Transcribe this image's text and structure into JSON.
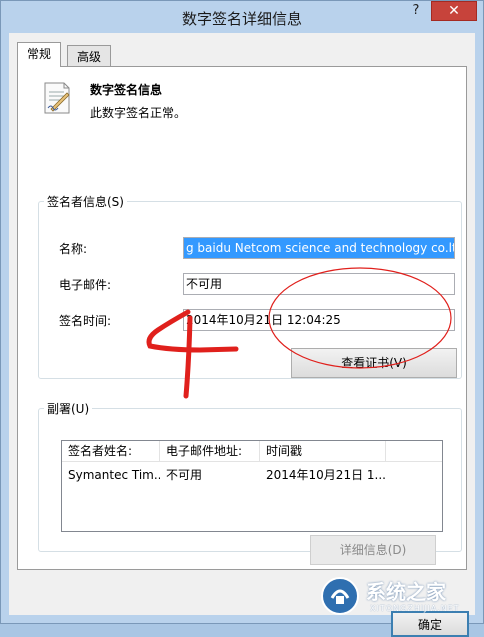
{
  "window": {
    "title": "数字签名详细信息",
    "help_label": "?",
    "close_label": "✕"
  },
  "tabs": [
    {
      "label": "常规"
    },
    {
      "label": "高级"
    }
  ],
  "info": {
    "title": "数字签名信息",
    "status": "此数字签名正常。"
  },
  "signer": {
    "legend": "签名者信息(S)",
    "name_label": "名称:",
    "name_value": "g baidu Netcom science and technology co.ltd",
    "email_label": "电子邮件:",
    "email_value": "不可用",
    "time_label": "签名时间:",
    "time_value": "2014年10月21日 12:04:25",
    "view_cert_button": "查看证书(V)"
  },
  "countersign": {
    "legend": "副署(U)",
    "columns": [
      "签名者姓名:",
      "电子邮件地址:",
      "时间戳"
    ],
    "rows": [
      {
        "name": "Symantec Tim...",
        "email": "不可用",
        "timestamp": "2014年10月21日 1..."
      }
    ],
    "details_button": "详细信息(D)"
  },
  "ok_button": "确定",
  "annotation": {
    "number": "4",
    "color": "#e0201c"
  },
  "watermark": {
    "text": "系统之家",
    "sub": "XITONGZHIJIA.NET"
  },
  "colors": {
    "selected_bg": "#3399ff",
    "close_bg": "#c7433b",
    "frame": "#b9d2ec"
  }
}
